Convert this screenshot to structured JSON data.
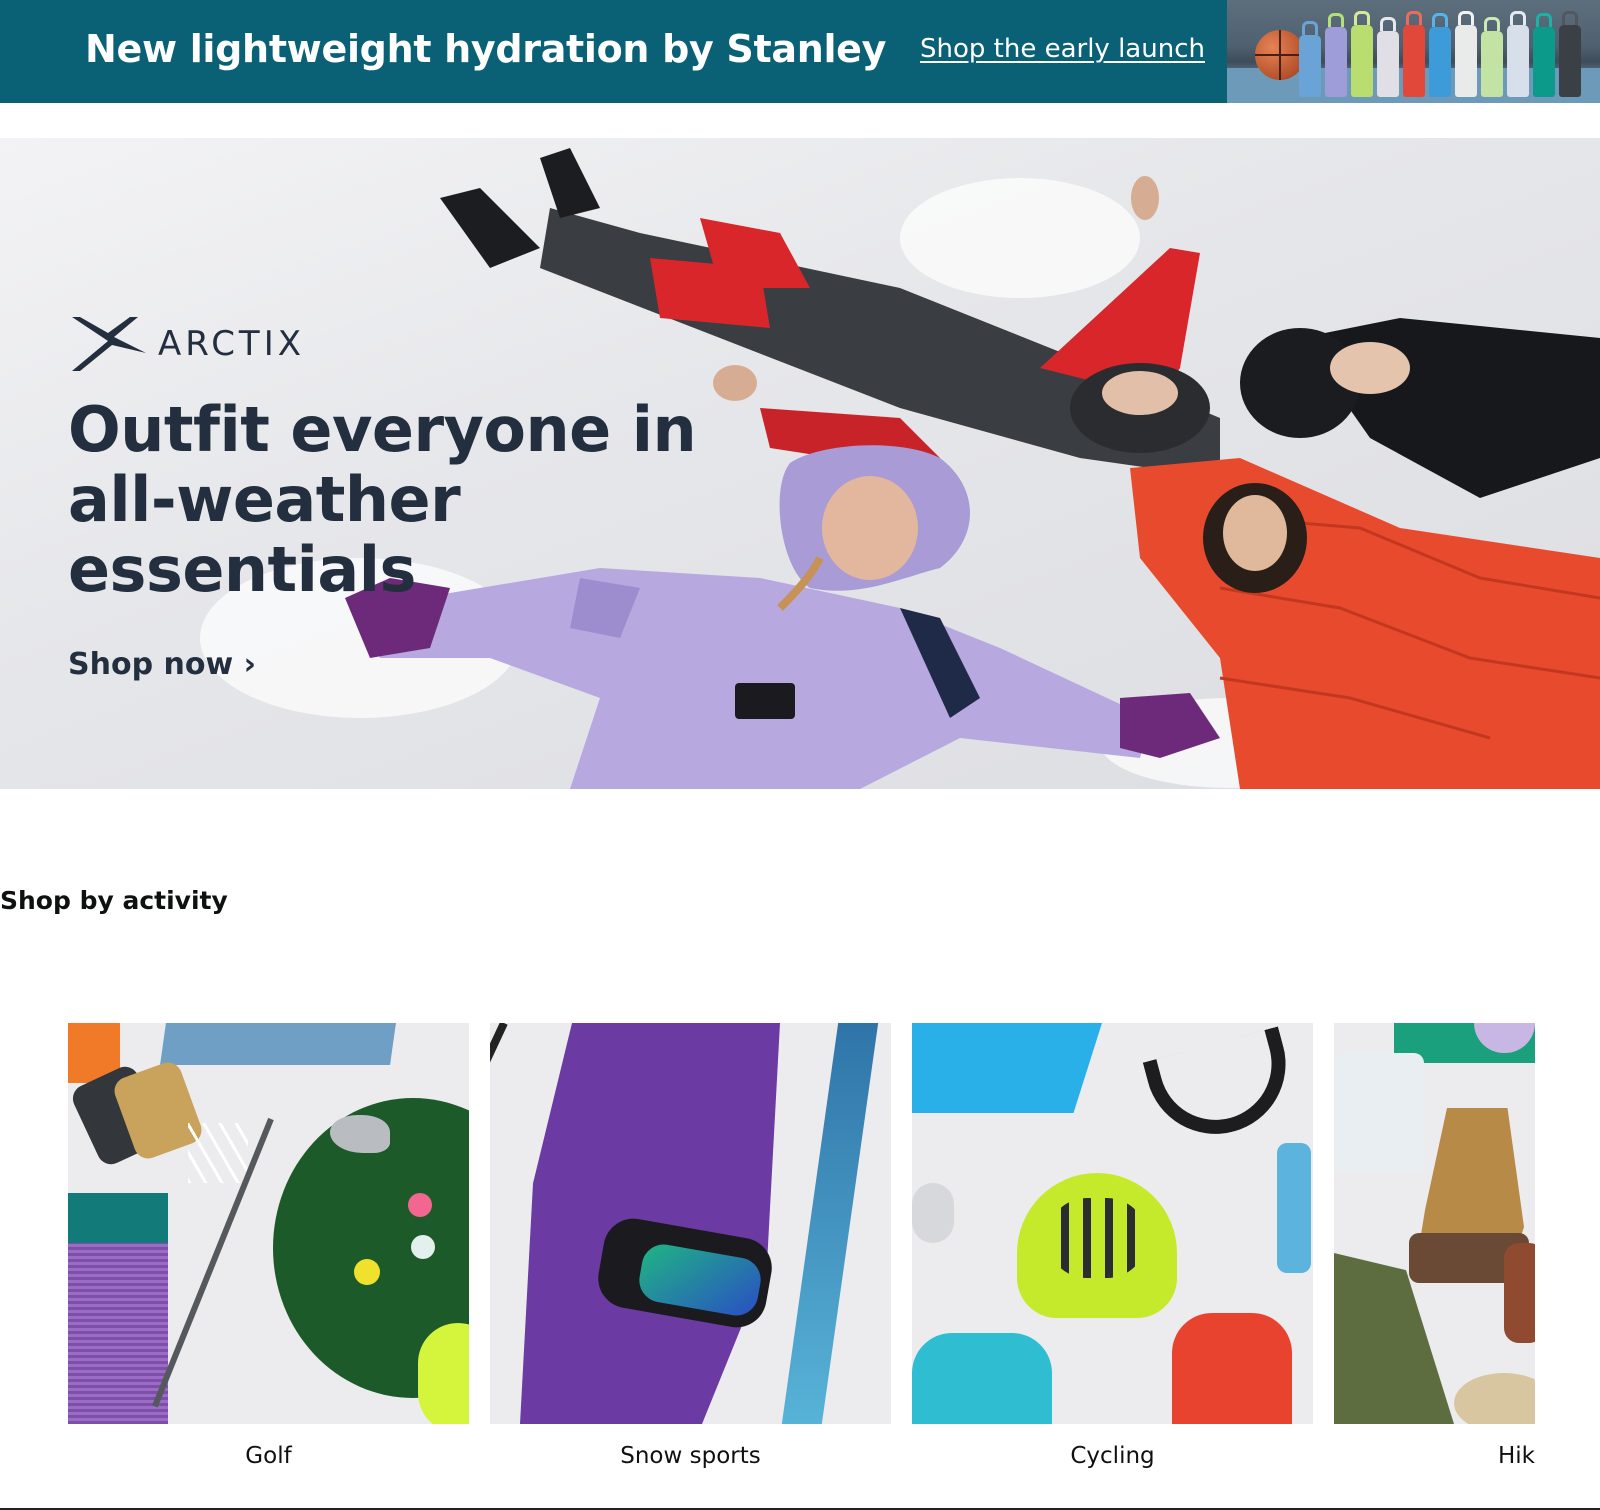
{
  "promo_banner": {
    "title": "New lightweight hydration by Stanley",
    "link": "Shop the early launch",
    "background_color": "#0a6175"
  },
  "hero": {
    "brand": "ARCTIX",
    "brand_icon": "arctix-logo-icon",
    "headline": "Outfit everyone in all-weather essentials",
    "cta": "Shop now ›"
  },
  "activity_section": {
    "title": "Shop by activity",
    "cards": [
      {
        "label": "Golf"
      },
      {
        "label": "Snow sports"
      },
      {
        "label": "Cycling"
      },
      {
        "label": "Hik"
      }
    ]
  }
}
